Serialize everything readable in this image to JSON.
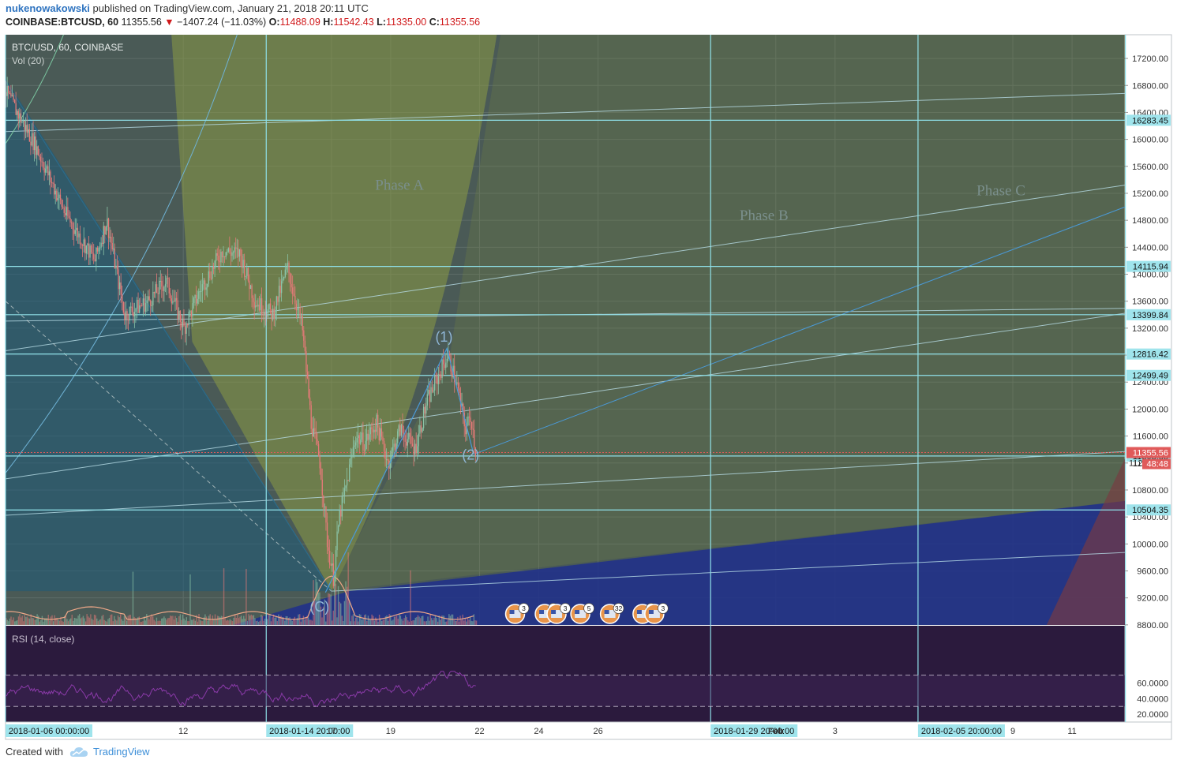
{
  "header": {
    "user": "nukenowakowski",
    "published": "published on TradingView.com, January 21, 2018 20:11 UTC",
    "symbol": "COINBASE:BTCUSD, 60",
    "last": "11355.56",
    "change": "−1407.24 (−11.03%)",
    "o_label": "O:",
    "o": "11488.09",
    "h_label": "H:",
    "h": "11542.43",
    "l_label": "L:",
    "l": "11335.00",
    "c_label": "C:",
    "c": "11355.56"
  },
  "footer": {
    "created": "Created with",
    "brand": "TradingView"
  },
  "colors": {
    "background": "#4a5a56",
    "up": "#8bc4a8",
    "down": "#e57a78",
    "hline": "#8fe0e8",
    "rsi_bg": "#2b1a3d",
    "rsi_line": "#8a3aa8",
    "price_tag": "#e05a5a",
    "level_tag": "#9fe4ec"
  },
  "chart_data": {
    "type": "candlestick",
    "title": "BTC/USD, 60, COINBASE",
    "volume_label": "Vol (20)",
    "rsi_label": "RSI (14, close)",
    "y_ticks": [
      17200,
      16800,
      16400,
      16000,
      15600,
      15200,
      14800,
      14400,
      14000,
      13600,
      13200,
      12800,
      12400,
      12000,
      11600,
      11200,
      10800,
      10400,
      10000,
      9600,
      9200,
      8800
    ],
    "y_tick_labels": [
      "17200.00",
      "16800.00",
      "16400.00",
      "16000.00",
      "15600.00",
      "15200.00",
      "14800.00",
      "14400.00",
      "14000.00",
      "13600.00",
      "13200.00",
      "12800.00",
      "12400.00",
      "12000.00",
      "11600.00",
      "11200.00",
      "10800.00",
      "10400.00",
      "10000.00",
      "9600.00",
      "9200.00",
      "8800.00"
    ],
    "ylim": [
      8560,
      17400
    ],
    "rsi_ticks": [
      "60.0000",
      "40.0000",
      "20.0000"
    ],
    "rsi_values": [
      60,
      40,
      20
    ],
    "rsi_bands": [
      70,
      30
    ],
    "levels": [
      {
        "value": 16283.45,
        "label": "16283.45"
      },
      {
        "value": 14115.94,
        "label": "14115.94"
      },
      {
        "value": 13399.84,
        "label": "13399.84"
      },
      {
        "value": 12816.42,
        "label": "12816.42"
      },
      {
        "value": 12499.49,
        "label": "12499.49"
      },
      {
        "value": 11303.85,
        "label": "11303.85"
      },
      {
        "value": 10504.35,
        "label": "10504.35"
      }
    ],
    "last_price": {
      "value": 11355.56,
      "label": "11355.56",
      "countdown": "48:48",
      "partial": "112"
    },
    "x_ticks": [
      {
        "label": "2018-01-06 00:00:00",
        "boxed": true,
        "day": 6
      },
      {
        "label": "12",
        "boxed": false,
        "day": 12
      },
      {
        "label": "2018-01-14 20:00:00",
        "boxed": true,
        "day": 14.8
      },
      {
        "label": "17",
        "boxed": false,
        "day": 17
      },
      {
        "label": "19",
        "boxed": false,
        "day": 19
      },
      {
        "label": "22",
        "boxed": false,
        "day": 22
      },
      {
        "label": "24",
        "boxed": false,
        "day": 24
      },
      {
        "label": "26",
        "boxed": false,
        "day": 26
      },
      {
        "label": "2018-01-29 20:00:00",
        "boxed": true,
        "day": 29.8
      },
      {
        "label": "Feb",
        "boxed": false,
        "bold": true,
        "day": 32
      },
      {
        "label": "3",
        "boxed": false,
        "day": 34
      },
      {
        "label": "2018-02-05 20:00:00",
        "boxed": true,
        "day": 36.8
      },
      {
        "label": "9",
        "boxed": false,
        "day": 40
      },
      {
        "label": "11",
        "boxed": false,
        "day": 42
      }
    ],
    "vertical_lines_day": [
      6,
      14.8,
      29.8,
      36.8,
      43.8
    ],
    "annotations": [
      {
        "text": "Phase A",
        "day": 19.3,
        "price": 15250
      },
      {
        "text": "Phase B",
        "day": 31.6,
        "price": 14800
      },
      {
        "text": "Phase C",
        "day": 39.6,
        "price": 15170
      },
      {
        "text": "(1)",
        "day": 20.8,
        "price": 13000
      },
      {
        "text": "(2)",
        "day": 21.7,
        "price": 11250
      },
      {
        "text": "(C)",
        "day": 16.6,
        "price": 9000
      }
    ],
    "wave_points": [
      {
        "day": 16.8,
        "price": 9280
      },
      {
        "day": 20.9,
        "price": 12900
      },
      {
        "day": 21.8,
        "price": 11330
      }
    ],
    "price_path": [
      {
        "day": 6.0,
        "price": 16700
      },
      {
        "day": 7.0,
        "price": 15900
      },
      {
        "day": 8.0,
        "price": 14900
      },
      {
        "day": 9.0,
        "price": 14200
      },
      {
        "day": 9.4,
        "price": 14800
      },
      {
        "day": 10.0,
        "price": 13400
      },
      {
        "day": 10.8,
        "price": 13600
      },
      {
        "day": 11.4,
        "price": 13900
      },
      {
        "day": 12.0,
        "price": 13200
      },
      {
        "day": 12.6,
        "price": 13800
      },
      {
        "day": 13.3,
        "price": 14350
      },
      {
        "day": 13.9,
        "price": 14300
      },
      {
        "day": 14.4,
        "price": 13600
      },
      {
        "day": 15.0,
        "price": 13400
      },
      {
        "day": 15.5,
        "price": 14100
      },
      {
        "day": 16.0,
        "price": 13200
      },
      {
        "day": 16.3,
        "price": 11800
      },
      {
        "day": 16.6,
        "price": 11200
      },
      {
        "day": 16.85,
        "price": 10000
      },
      {
        "day": 17.05,
        "price": 9500
      },
      {
        "day": 17.25,
        "price": 10400
      },
      {
        "day": 17.5,
        "price": 10900
      },
      {
        "day": 17.8,
        "price": 11600
      },
      {
        "day": 18.1,
        "price": 11500
      },
      {
        "day": 18.5,
        "price": 11800
      },
      {
        "day": 18.9,
        "price": 11200
      },
      {
        "day": 19.3,
        "price": 11700
      },
      {
        "day": 19.8,
        "price": 11400
      },
      {
        "day": 20.2,
        "price": 12100
      },
      {
        "day": 20.6,
        "price": 12500
      },
      {
        "day": 20.9,
        "price": 12800
      },
      {
        "day": 21.2,
        "price": 12400
      },
      {
        "day": 21.5,
        "price": 11700
      },
      {
        "day": 21.7,
        "price": 11900
      },
      {
        "day": 21.85,
        "price": 11360
      }
    ],
    "events": [
      {
        "day": 23.2,
        "count": "3"
      },
      {
        "day": 24.2,
        "count": "2"
      },
      {
        "day": 24.6,
        "count": "3"
      },
      {
        "day": 25.4,
        "count": "5"
      },
      {
        "day": 26.4,
        "count": "32"
      },
      {
        "day": 27.5,
        "count": "10"
      },
      {
        "day": 27.9,
        "count": "3"
      }
    ]
  }
}
